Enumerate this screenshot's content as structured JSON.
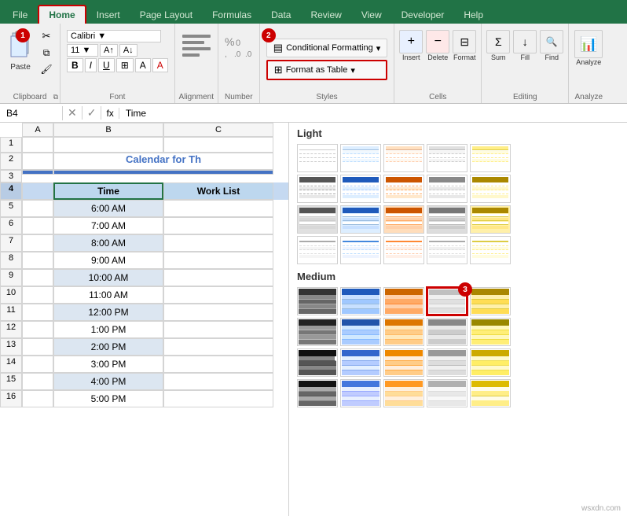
{
  "tabs": [
    {
      "label": "File",
      "active": false
    },
    {
      "label": "Home",
      "active": true
    },
    {
      "label": "Insert",
      "active": false
    },
    {
      "label": "Page Layout",
      "active": false
    },
    {
      "label": "Formulas",
      "active": false
    },
    {
      "label": "Data",
      "active": false
    },
    {
      "label": "Review",
      "active": false
    },
    {
      "label": "View",
      "active": false
    },
    {
      "label": "Developer",
      "active": false
    },
    {
      "label": "Help",
      "active": false
    }
  ],
  "ribbon": {
    "clipboard_label": "Clipboard",
    "font_label": "Font",
    "alignment_label": "Alignment",
    "number_label": "Number",
    "styles_label": "Styles",
    "cells_label": "Cells",
    "editing_label": "Editing",
    "analyze_label": "Analyze",
    "conditional_formatting": "Conditional Formatting",
    "format_as_table": "Format as Table",
    "badge1": "1",
    "badge2": "2",
    "badge3": "3"
  },
  "formula_bar": {
    "cell_ref": "B4",
    "formula": "Time"
  },
  "spreadsheet": {
    "title": "Calendar for Th",
    "col_headers": [
      "A",
      "B",
      "C"
    ],
    "row_headers": [
      "1",
      "2",
      "3",
      "4",
      "5",
      "6",
      "7",
      "8",
      "9",
      "10",
      "11",
      "12",
      "13",
      "14",
      "15",
      "16"
    ],
    "data_header": [
      "Time",
      "Work List"
    ],
    "times": [
      "6:00 AM",
      "7:00 AM",
      "8:00 AM",
      "9:00 AM",
      "10:00 AM",
      "11:00 AM",
      "12:00 PM",
      "1:00 PM",
      "2:00 PM",
      "3:00 PM",
      "4:00 PM",
      "5:00 PM"
    ]
  },
  "table_styles": {
    "light_label": "Light",
    "medium_label": "Medium",
    "light_styles": [
      {
        "header": "#ffffff",
        "row1": "#ffffff",
        "row2": "#e0e0e0",
        "variant": "white-gray"
      },
      {
        "header": "#ddeeff",
        "row1": "#ffffff",
        "row2": "#c8e4ff",
        "variant": "light-blue"
      },
      {
        "header": "#ffe0cc",
        "row1": "#ffffff",
        "row2": "#ffd0aa",
        "variant": "light-orange"
      },
      {
        "header": "#e0e0e0",
        "row1": "#ffffff",
        "row2": "#cccccc",
        "variant": "light-gray"
      },
      {
        "header": "#ffff99",
        "row1": "#ffffff",
        "row2": "#ffffcc",
        "variant": "light-yellow"
      },
      {
        "header": "#ffffff",
        "row1": "#ffffff",
        "row2": "#e0e0e0",
        "variant": "white-gray2"
      },
      {
        "header": "#ddeeff",
        "row1": "#ffffff",
        "row2": "#c8e4ff",
        "variant": "light-blue2"
      },
      {
        "header": "#ffffff",
        "row1": "#ffffff",
        "row2": "#e0e0e0",
        "variant": "wg3"
      },
      {
        "header": "#ddeeff",
        "row1": "#ddeeff",
        "row2": "#c8e4ff",
        "variant": "lb3"
      },
      {
        "header": "#ffe0cc",
        "row1": "#ffe0cc",
        "row2": "#ffd0aa",
        "variant": "lo3"
      },
      {
        "header": "#e0e0e0",
        "row1": "#e0e0e0",
        "row2": "#cccccc",
        "variant": "lg3"
      },
      {
        "header": "#ffff99",
        "row1": "#ffff99",
        "row2": "#ffee44",
        "variant": "ly3"
      },
      {
        "header": "#4a4a4a",
        "row1": "#888888",
        "row2": "#666666",
        "variant": "dark1"
      },
      {
        "header": "#1f5abb",
        "row1": "#aaccff",
        "row2": "#4488dd",
        "variant": "blue-dark"
      },
      {
        "header": "#cc6600",
        "row1": "#ffaa66",
        "row2": "#ff8833",
        "variant": "orange-dark"
      },
      {
        "header": "#888888",
        "row1": "#cccccc",
        "row2": "#aaaaaa",
        "variant": "gray-dark"
      },
      {
        "header": "#cc9900",
        "row1": "#ffee99",
        "row2": "#ffcc33",
        "variant": "gold-dark"
      },
      {
        "header": "#ffffff",
        "row1": "#eef4ff",
        "row2": "#d4e8ff",
        "variant": "wlb"
      },
      {
        "header": "#ddeeff",
        "row1": "#eef4ff",
        "row2": "#c8e4ff",
        "variant": "lb4"
      },
      {
        "header": "#ffe8d4",
        "row1": "#fff0e8",
        "row2": "#ffd8b4",
        "variant": "lo4"
      },
      {
        "header": "#e8e8e8",
        "row1": "#f0f0f0",
        "row2": "#d8d8d8",
        "variant": "lg4"
      },
      {
        "header": "#fff8c0",
        "row1": "#fffce0",
        "row2": "#ffee88",
        "variant": "ly4"
      }
    ],
    "medium_styles": [
      {
        "header": "#4a4a4a",
        "row1": "#888888",
        "row2": "#666666",
        "variant": "m-dark1"
      },
      {
        "header": "#1f5abb",
        "row1": "#aaccff",
        "row2": "#4488dd",
        "variant": "m-blue"
      },
      {
        "header": "#cc6600",
        "row1": "#ffaa66",
        "row2": "#ff8833",
        "variant": "m-orange"
      },
      {
        "header": "#c0c0c0",
        "row1": "#e8e8e8",
        "row2": "#d0d0d0",
        "variant": "m-gray",
        "selected": true
      },
      {
        "header": "#cc9900",
        "row1": "#ffee99",
        "row2": "#ffcc33",
        "variant": "m-gold"
      },
      {
        "header": "#4a4a4a",
        "row1": "#aaaaaa",
        "row2": "#888888",
        "variant": "m-dark2"
      },
      {
        "header": "#2255aa",
        "row1": "#bbddff",
        "row2": "#5599ee",
        "variant": "m-blue2"
      },
      {
        "header": "#dd7700",
        "row1": "#ffcc88",
        "row2": "#ff9944",
        "variant": "m-orange2"
      },
      {
        "header": "#999999",
        "row1": "#dddddd",
        "row2": "#bbbbbb",
        "variant": "m-gray2"
      },
      {
        "header": "#ddaa00",
        "row1": "#fff0aa",
        "row2": "#ffdd55",
        "variant": "m-gold2"
      },
      {
        "header": "#333333",
        "row1": "#999999",
        "row2": "#777777",
        "variant": "m-dark3"
      },
      {
        "header": "#3366cc",
        "row1": "#c4d9f8",
        "row2": "#6699ee",
        "variant": "m-blue3"
      },
      {
        "header": "#ee8800",
        "row1": "#ffd9aa",
        "row2": "#ffaa44",
        "variant": "m-orange3"
      },
      {
        "header": "#aaaaaa",
        "row1": "#e8e8e8",
        "row2": "#cccccc",
        "variant": "m-gray3"
      },
      {
        "header": "#ccaa00",
        "row1": "#fff4bb",
        "row2": "#ffdd44",
        "variant": "m-gold3"
      },
      {
        "header": "#222222",
        "row1": "#888888",
        "row2": "#555555",
        "variant": "m-dark4"
      },
      {
        "header": "#4477dd",
        "row1": "#d0e4ff",
        "row2": "#7799ff",
        "variant": "m-blue4"
      },
      {
        "header": "#ff9922",
        "row1": "#ffe4bb",
        "row2": "#ffbb55",
        "variant": "m-orange4"
      },
      {
        "header": "#b0b0b0",
        "row1": "#efefef",
        "row2": "#d5d5d5",
        "variant": "m-gray4"
      },
      {
        "header": "#ddbb00",
        "row1": "#fff8cc",
        "row2": "#ffee66",
        "variant": "m-gold4"
      }
    ]
  },
  "watermark": "wsxdn.com"
}
